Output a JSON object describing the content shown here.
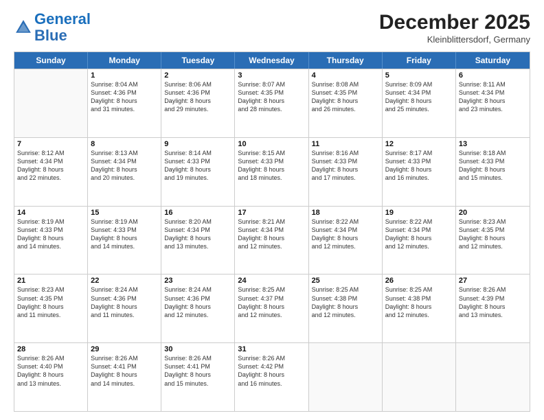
{
  "header": {
    "logo_general": "General",
    "logo_blue": "Blue",
    "month": "December 2025",
    "location": "Kleinblittersdorf, Germany"
  },
  "weekdays": [
    "Sunday",
    "Monday",
    "Tuesday",
    "Wednesday",
    "Thursday",
    "Friday",
    "Saturday"
  ],
  "weeks": [
    [
      {
        "day": "",
        "info": ""
      },
      {
        "day": "1",
        "info": "Sunrise: 8:04 AM\nSunset: 4:36 PM\nDaylight: 8 hours\nand 31 minutes."
      },
      {
        "day": "2",
        "info": "Sunrise: 8:06 AM\nSunset: 4:36 PM\nDaylight: 8 hours\nand 29 minutes."
      },
      {
        "day": "3",
        "info": "Sunrise: 8:07 AM\nSunset: 4:35 PM\nDaylight: 8 hours\nand 28 minutes."
      },
      {
        "day": "4",
        "info": "Sunrise: 8:08 AM\nSunset: 4:35 PM\nDaylight: 8 hours\nand 26 minutes."
      },
      {
        "day": "5",
        "info": "Sunrise: 8:09 AM\nSunset: 4:34 PM\nDaylight: 8 hours\nand 25 minutes."
      },
      {
        "day": "6",
        "info": "Sunrise: 8:11 AM\nSunset: 4:34 PM\nDaylight: 8 hours\nand 23 minutes."
      }
    ],
    [
      {
        "day": "7",
        "info": "Sunrise: 8:12 AM\nSunset: 4:34 PM\nDaylight: 8 hours\nand 22 minutes."
      },
      {
        "day": "8",
        "info": "Sunrise: 8:13 AM\nSunset: 4:34 PM\nDaylight: 8 hours\nand 20 minutes."
      },
      {
        "day": "9",
        "info": "Sunrise: 8:14 AM\nSunset: 4:33 PM\nDaylight: 8 hours\nand 19 minutes."
      },
      {
        "day": "10",
        "info": "Sunrise: 8:15 AM\nSunset: 4:33 PM\nDaylight: 8 hours\nand 18 minutes."
      },
      {
        "day": "11",
        "info": "Sunrise: 8:16 AM\nSunset: 4:33 PM\nDaylight: 8 hours\nand 17 minutes."
      },
      {
        "day": "12",
        "info": "Sunrise: 8:17 AM\nSunset: 4:33 PM\nDaylight: 8 hours\nand 16 minutes."
      },
      {
        "day": "13",
        "info": "Sunrise: 8:18 AM\nSunset: 4:33 PM\nDaylight: 8 hours\nand 15 minutes."
      }
    ],
    [
      {
        "day": "14",
        "info": "Sunrise: 8:19 AM\nSunset: 4:33 PM\nDaylight: 8 hours\nand 14 minutes."
      },
      {
        "day": "15",
        "info": "Sunrise: 8:19 AM\nSunset: 4:33 PM\nDaylight: 8 hours\nand 14 minutes."
      },
      {
        "day": "16",
        "info": "Sunrise: 8:20 AM\nSunset: 4:34 PM\nDaylight: 8 hours\nand 13 minutes."
      },
      {
        "day": "17",
        "info": "Sunrise: 8:21 AM\nSunset: 4:34 PM\nDaylight: 8 hours\nand 12 minutes."
      },
      {
        "day": "18",
        "info": "Sunrise: 8:22 AM\nSunset: 4:34 PM\nDaylight: 8 hours\nand 12 minutes."
      },
      {
        "day": "19",
        "info": "Sunrise: 8:22 AM\nSunset: 4:34 PM\nDaylight: 8 hours\nand 12 minutes."
      },
      {
        "day": "20",
        "info": "Sunrise: 8:23 AM\nSunset: 4:35 PM\nDaylight: 8 hours\nand 12 minutes."
      }
    ],
    [
      {
        "day": "21",
        "info": "Sunrise: 8:23 AM\nSunset: 4:35 PM\nDaylight: 8 hours\nand 11 minutes."
      },
      {
        "day": "22",
        "info": "Sunrise: 8:24 AM\nSunset: 4:36 PM\nDaylight: 8 hours\nand 11 minutes."
      },
      {
        "day": "23",
        "info": "Sunrise: 8:24 AM\nSunset: 4:36 PM\nDaylight: 8 hours\nand 12 minutes."
      },
      {
        "day": "24",
        "info": "Sunrise: 8:25 AM\nSunset: 4:37 PM\nDaylight: 8 hours\nand 12 minutes."
      },
      {
        "day": "25",
        "info": "Sunrise: 8:25 AM\nSunset: 4:38 PM\nDaylight: 8 hours\nand 12 minutes."
      },
      {
        "day": "26",
        "info": "Sunrise: 8:25 AM\nSunset: 4:38 PM\nDaylight: 8 hours\nand 12 minutes."
      },
      {
        "day": "27",
        "info": "Sunrise: 8:26 AM\nSunset: 4:39 PM\nDaylight: 8 hours\nand 13 minutes."
      }
    ],
    [
      {
        "day": "28",
        "info": "Sunrise: 8:26 AM\nSunset: 4:40 PM\nDaylight: 8 hours\nand 13 minutes."
      },
      {
        "day": "29",
        "info": "Sunrise: 8:26 AM\nSunset: 4:41 PM\nDaylight: 8 hours\nand 14 minutes."
      },
      {
        "day": "30",
        "info": "Sunrise: 8:26 AM\nSunset: 4:41 PM\nDaylight: 8 hours\nand 15 minutes."
      },
      {
        "day": "31",
        "info": "Sunrise: 8:26 AM\nSunset: 4:42 PM\nDaylight: 8 hours\nand 16 minutes."
      },
      {
        "day": "",
        "info": ""
      },
      {
        "day": "",
        "info": ""
      },
      {
        "day": "",
        "info": ""
      }
    ]
  ]
}
